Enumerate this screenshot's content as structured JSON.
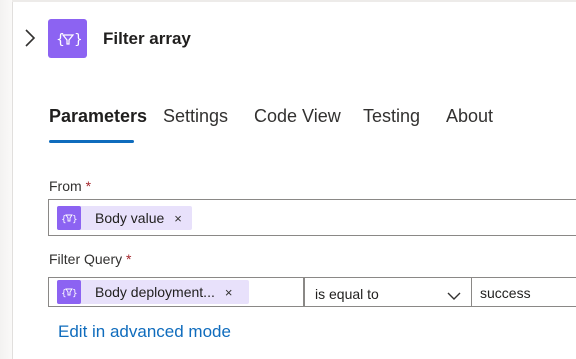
{
  "action": {
    "title": "Filter array",
    "icon": "filter-array-icon",
    "accent_color": "#8c63f2"
  },
  "tabs": [
    {
      "label": "Parameters",
      "active": true
    },
    {
      "label": "Settings",
      "active": false
    },
    {
      "label": "Code View",
      "active": false
    },
    {
      "label": "Testing",
      "active": false
    },
    {
      "label": "About",
      "active": false
    }
  ],
  "from": {
    "label": "From",
    "required_mark": "*",
    "token": {
      "label": "Body value",
      "remove": "×"
    }
  },
  "filter_query": {
    "label": "Filter Query",
    "required_mark": "*",
    "token": {
      "label": "Body deployment...",
      "remove": "×"
    },
    "operator": "is equal to",
    "value": "success"
  },
  "advanced_link": "Edit in advanced mode"
}
